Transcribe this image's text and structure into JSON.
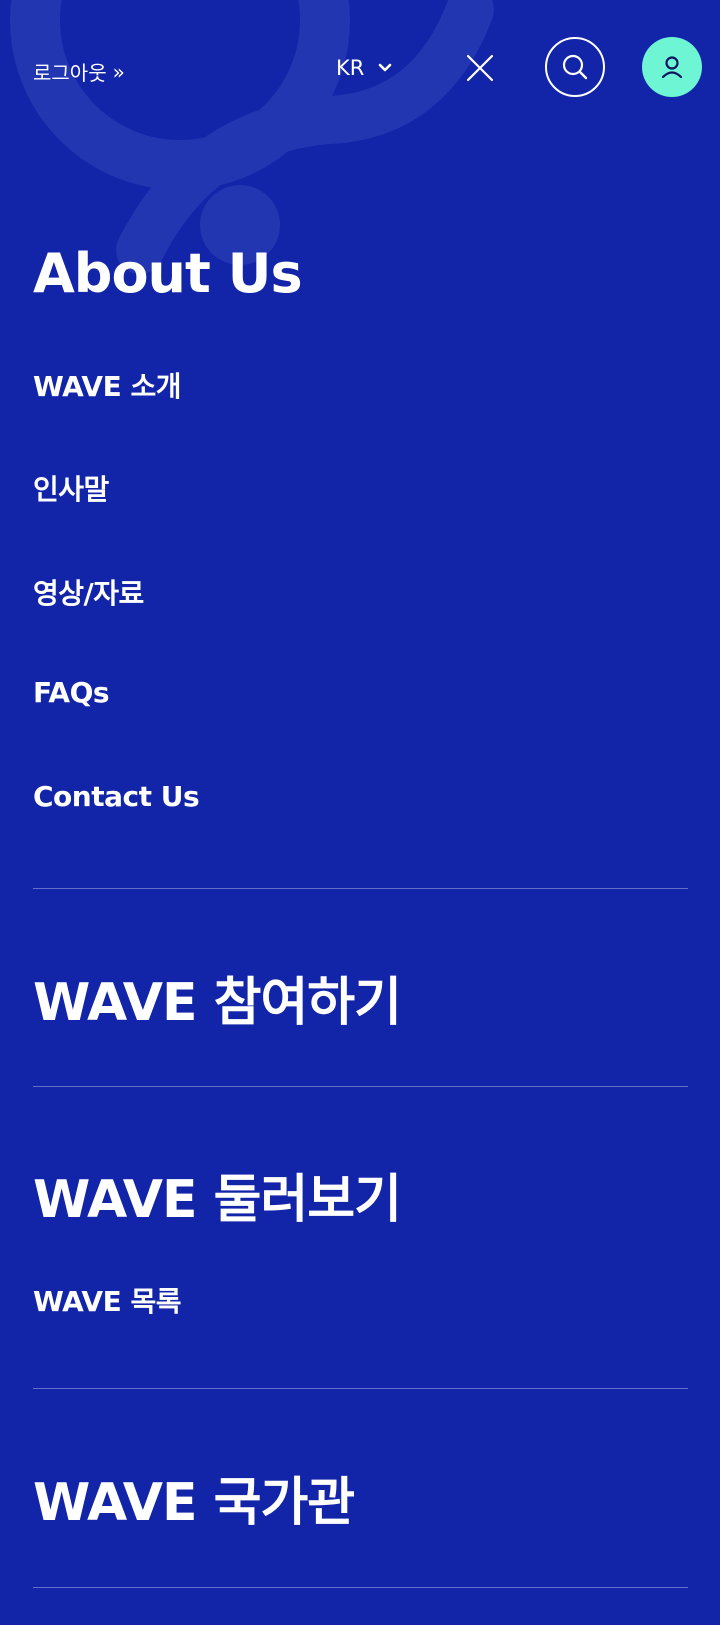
{
  "header": {
    "logout_label": "로그아웃",
    "logout_chevron": "»",
    "language": "KR",
    "icons": {
      "close": "close-icon",
      "search": "search-icon",
      "user": "user-icon",
      "lang_chevron": "chevron-down-icon"
    }
  },
  "colors": {
    "background": "#1224a8",
    "accent": "#6ef5d4",
    "text": "#ffffff"
  },
  "menu": {
    "about": {
      "title": "About Us",
      "items": [
        {
          "label": "WAVE 소개"
        },
        {
          "label": "인사말"
        },
        {
          "label": "영상/자료"
        },
        {
          "label": "FAQs"
        },
        {
          "label": "Contact Us"
        }
      ]
    },
    "participate": {
      "title": "WAVE 참여하기"
    },
    "browse": {
      "title": "WAVE 둘러보기",
      "items": [
        {
          "label": "WAVE 목록"
        }
      ]
    },
    "national": {
      "title": "WAVE 국가관"
    }
  }
}
